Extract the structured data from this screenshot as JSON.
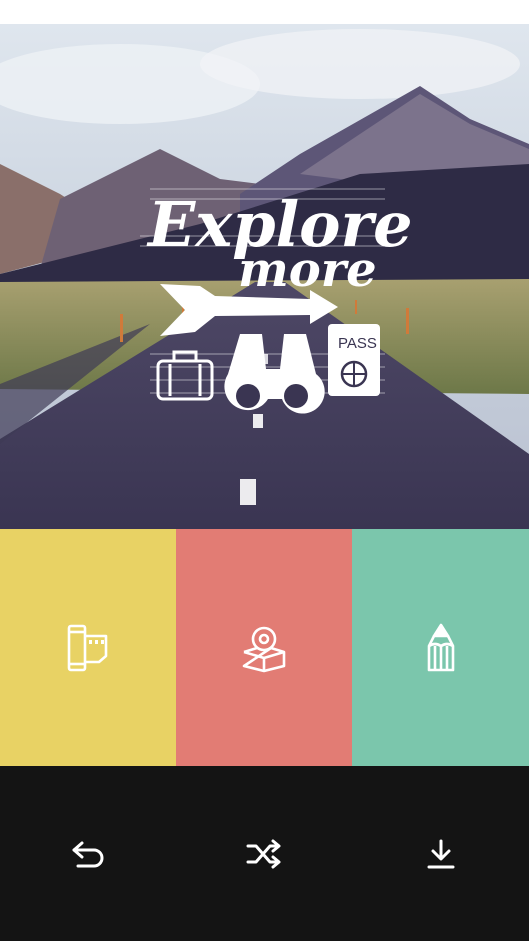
{
  "photo": {
    "title_line1": "Explore",
    "title_line2": "more",
    "passport_label": "PASS"
  },
  "tools": [
    {
      "id": "film",
      "icon": "film-roll-icon",
      "color": "#E8D264"
    },
    {
      "id": "stamp",
      "icon": "stamp-icon",
      "color": "#E27C74"
    },
    {
      "id": "pencil",
      "icon": "pencil-icon",
      "color": "#7BC6AC"
    }
  ],
  "bottom_bar": {
    "icons": [
      "undo-icon",
      "shuffle-icon",
      "download-icon"
    ],
    "background": "#141414"
  }
}
